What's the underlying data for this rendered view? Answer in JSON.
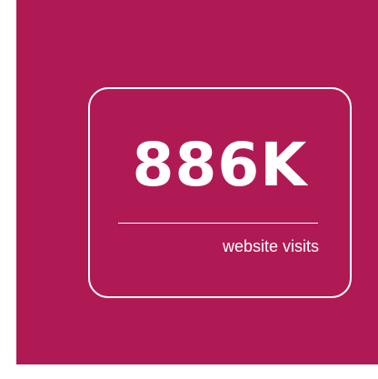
{
  "stat": {
    "value": "886K",
    "label": "website visits"
  },
  "colors": {
    "background": "#b01a54",
    "foreground": "#ffffff"
  }
}
